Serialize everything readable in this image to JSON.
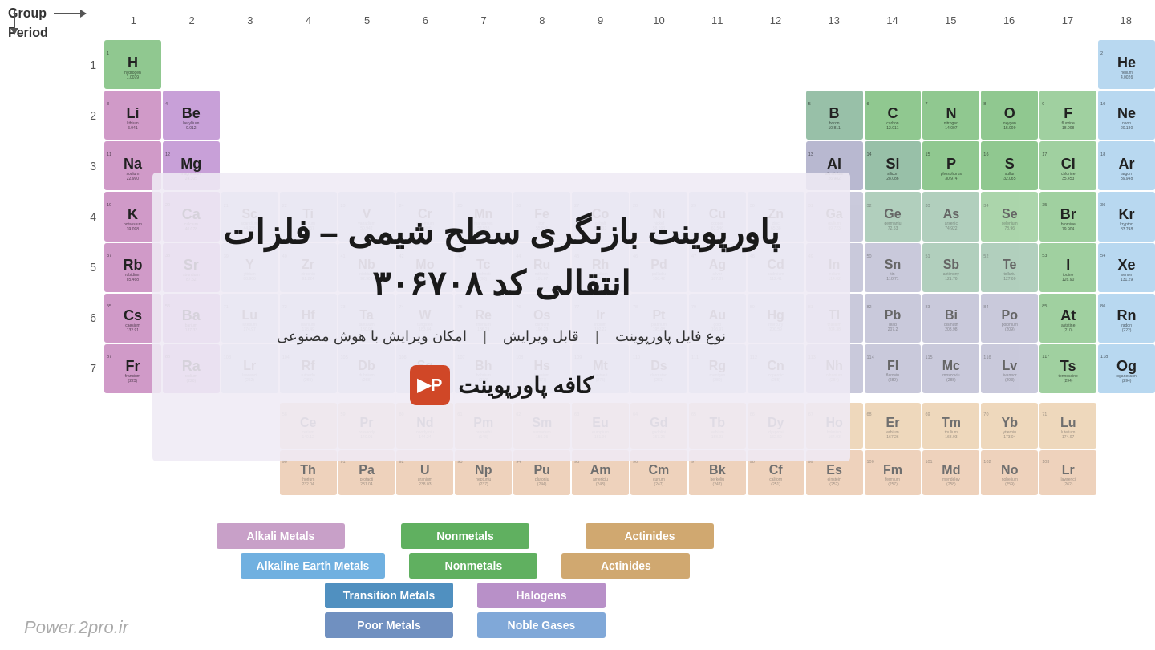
{
  "header": {
    "group_label": "Group",
    "period_label": "Period",
    "groups": [
      "1",
      "2",
      "3",
      "4",
      "5",
      "6",
      "7",
      "8",
      "9",
      "10",
      "11",
      "12",
      "13",
      "14",
      "15",
      "16",
      "17",
      "18"
    ],
    "periods": [
      "1",
      "2",
      "3",
      "4",
      "5",
      "6",
      "7"
    ]
  },
  "main": {
    "heading_line1": "پاورپوینت بازنگری سطح شیمی – فلزات",
    "heading_line2": "انتقالی کد ۳۰۶۷۰۸",
    "info_bar": {
      "item1": "نوع فایل پاورپوینت",
      "sep1": "|",
      "item2": "قابل ویرایش",
      "sep2": "|",
      "item3": "امکان ویرایش با هوش مصنوعی"
    },
    "logo_text": "کافه پاورپوینت"
  },
  "legend": {
    "row1": [
      {
        "label": "Alkali Metals",
        "class": "pill-alkali"
      },
      {
        "label": "Nonmetals",
        "class": "pill-nonmetal"
      },
      {
        "label": "Actinides",
        "class": "pill-actinides"
      }
    ],
    "row2": [
      {
        "label": "Transition Metals",
        "class": "pill-transition"
      },
      {
        "label": "Halogens",
        "class": "pill-halogens"
      }
    ],
    "row3": [
      {
        "label": "Poor Metals",
        "class": "pill-poor"
      },
      {
        "label": "Noble Gases",
        "class": "pill-noble"
      }
    ],
    "row0": [
      {
        "label": "Alkaline Earth Metals",
        "class": "pill-alkaline"
      },
      {
        "label": "Nonmetals",
        "class": "pill-nonmetal"
      },
      {
        "label": "Actinides",
        "class": "pill-actinides"
      }
    ]
  },
  "watermark": "Power.2pro.ir",
  "elements": {
    "H": {
      "num": 1,
      "sym": "H",
      "name": "hydrogen",
      "mass": "1.0079",
      "col": 1,
      "row": 1,
      "type": "hydrogen-el"
    },
    "He": {
      "num": 2,
      "sym": "He",
      "name": "helium",
      "mass": "4.0026",
      "col": 18,
      "row": 1,
      "type": "noble-gas"
    },
    "Li": {
      "num": 3,
      "sym": "Li",
      "name": "lithium",
      "mass": "6.941",
      "col": 1,
      "row": 2,
      "type": "alkali"
    },
    "Be": {
      "num": 4,
      "sym": "Be",
      "name": "beryllium",
      "mass": "9.012",
      "col": 2,
      "row": 2,
      "type": "alkaline-earth"
    },
    "B": {
      "num": 5,
      "sym": "B",
      "name": "boron",
      "mass": "10.811",
      "col": 13,
      "row": 2,
      "type": "metalloid"
    },
    "C": {
      "num": 6,
      "sym": "C",
      "name": "carbon",
      "mass": "12.011",
      "col": 14,
      "row": 2,
      "type": "nonmetal"
    },
    "N": {
      "num": 7,
      "sym": "N",
      "name": "nitrogen",
      "mass": "14.007",
      "col": 15,
      "row": 2,
      "type": "nonmetal"
    },
    "O": {
      "num": 8,
      "sym": "O",
      "name": "oxygen",
      "mass": "15.999",
      "col": 16,
      "row": 2,
      "type": "nonmetal"
    },
    "F": {
      "num": 9,
      "sym": "F",
      "name": "fluorine",
      "mass": "18.998",
      "col": 17,
      "row": 2,
      "type": "halogen"
    },
    "Ne": {
      "num": 10,
      "sym": "Ne",
      "name": "neon",
      "mass": "20.180",
      "col": 18,
      "row": 2,
      "type": "noble-gas"
    },
    "Na": {
      "num": 11,
      "sym": "Na",
      "name": "sodium",
      "mass": "22.990",
      "col": 1,
      "row": 3,
      "type": "alkali"
    },
    "Mg": {
      "num": 12,
      "sym": "Mg",
      "name": "magnesium",
      "mass": "24.305",
      "col": 2,
      "row": 3,
      "type": "alkaline-earth"
    },
    "Al": {
      "num": 13,
      "sym": "Al",
      "name": "aluminium",
      "mass": "26.982",
      "col": 13,
      "row": 3,
      "type": "post-transition"
    },
    "Si": {
      "num": 14,
      "sym": "Si",
      "name": "silicon",
      "mass": "28.086",
      "col": 14,
      "row": 3,
      "type": "metalloid"
    },
    "P": {
      "num": 15,
      "sym": "P",
      "name": "phosphorus",
      "mass": "30.974",
      "col": 15,
      "row": 3,
      "type": "nonmetal"
    },
    "S": {
      "num": 16,
      "sym": "S",
      "name": "sulfur",
      "mass": "32.065",
      "col": 16,
      "row": 3,
      "type": "nonmetal"
    },
    "Cl": {
      "num": 17,
      "sym": "Cl",
      "name": "chlorine",
      "mass": "35.453",
      "col": 17,
      "row": 3,
      "type": "halogen"
    },
    "Ar": {
      "num": 18,
      "sym": "Ar",
      "name": "argon",
      "mass": "39.948",
      "col": 18,
      "row": 3,
      "type": "noble-gas"
    },
    "K": {
      "num": 19,
      "sym": "K",
      "name": "potassium",
      "mass": "39.098",
      "col": 1,
      "row": 4,
      "type": "alkali"
    },
    "Ca": {
      "num": 20,
      "sym": "Ca",
      "name": "calcium",
      "mass": "40.078",
      "col": 2,
      "row": 4,
      "type": "alkaline-earth"
    },
    "Br": {
      "num": 35,
      "sym": "Br",
      "name": "bromine",
      "mass": "79.904",
      "col": 17,
      "row": 4,
      "type": "halogen"
    },
    "Kr": {
      "num": 36,
      "sym": "Kr",
      "name": "krypton",
      "mass": "83.798",
      "col": 18,
      "row": 4,
      "type": "noble-gas"
    },
    "Rb": {
      "num": 37,
      "sym": "Rb",
      "name": "rubidium",
      "mass": "85.468",
      "col": 1,
      "row": 5,
      "type": "alkali"
    },
    "Sr": {
      "num": 38,
      "sym": "Sr",
      "name": "strontium",
      "mass": "87.62",
      "col": 2,
      "row": 5,
      "type": "alkaline-earth"
    },
    "I": {
      "num": 53,
      "sym": "I",
      "name": "iodine",
      "mass": "126.90",
      "col": 17,
      "row": 5,
      "type": "halogen"
    },
    "Xe": {
      "num": 54,
      "sym": "Xe",
      "name": "xenon",
      "mass": "131.29",
      "col": 18,
      "row": 5,
      "type": "noble-gas"
    },
    "Cs": {
      "num": 55,
      "sym": "Cs",
      "name": "caesium",
      "mass": "132.91",
      "col": 1,
      "row": 6,
      "type": "alkali"
    },
    "Ba": {
      "num": 56,
      "sym": "Ba",
      "name": "barium",
      "mass": "137.33",
      "col": 2,
      "row": 6,
      "type": "alkaline-earth"
    },
    "At": {
      "num": 85,
      "sym": "At",
      "name": "astatine",
      "mass": "(210)",
      "col": 17,
      "row": 6,
      "type": "halogen"
    },
    "Rn": {
      "num": 86,
      "sym": "Rn",
      "name": "radon",
      "mass": "(222)",
      "col": 18,
      "row": 6,
      "type": "noble-gas"
    },
    "Fr": {
      "num": 87,
      "sym": "Fr",
      "name": "francium",
      "mass": "(223)",
      "col": 1,
      "row": 7,
      "type": "alkali"
    },
    "Ra": {
      "num": 88,
      "sym": "Ra",
      "name": "radium",
      "mass": "(226)",
      "col": 2,
      "row": 7,
      "type": "alkaline-earth"
    },
    "Ts": {
      "num": 117,
      "sym": "Ts",
      "name": "tennessine",
      "mass": "(294)",
      "col": 17,
      "row": 7,
      "type": "halogen"
    },
    "Og": {
      "num": 118,
      "sym": "Og",
      "name": "oganesson",
      "mass": "(294)",
      "col": 18,
      "row": 7,
      "type": "noble-gas"
    },
    "Yb": {
      "num": 70,
      "sym": "Yb",
      "name": "ytterbium",
      "mass": "173.04",
      "col": 16,
      "row": 8,
      "type": "lanthanide"
    },
    "Lu": {
      "num": 71,
      "sym": "Lu",
      "name": "lutetium",
      "mass": "174.97",
      "col": 17,
      "row": 8,
      "type": "lanthanide"
    },
    "No": {
      "num": 102,
      "sym": "No",
      "name": "nobelium",
      "mass": "(259)",
      "col": 16,
      "row": 9,
      "type": "actinide"
    },
    "Lr": {
      "num": 103,
      "sym": "Lr",
      "name": "lawrencium",
      "mass": "(262)",
      "col": 17,
      "row": 9,
      "type": "actinide"
    }
  }
}
